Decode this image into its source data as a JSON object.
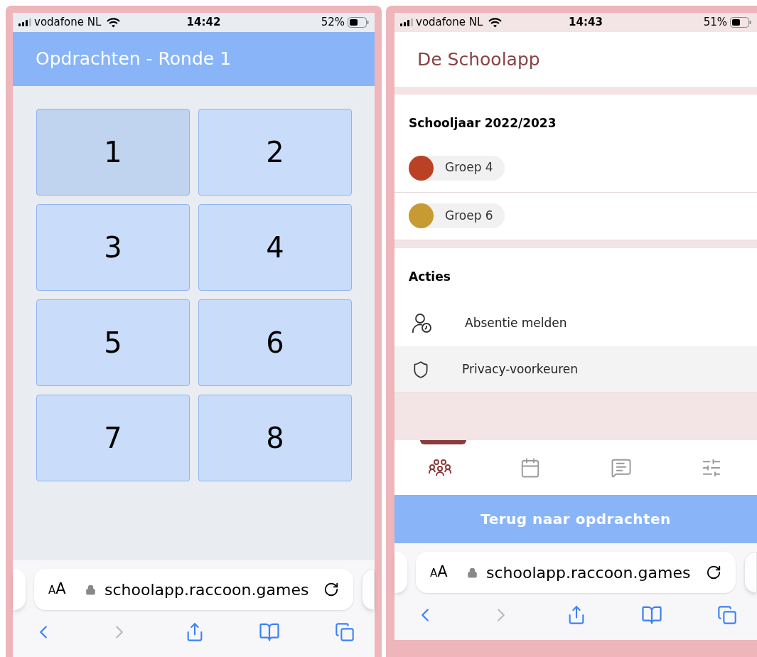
{
  "assignments_screen": {
    "status_bar": {
      "carrier": "vodafone NL",
      "time": "14:42",
      "battery": "52%"
    },
    "title": "Opdrachten - Ronde 1",
    "tiles": [
      {
        "label": "1",
        "selected": true
      },
      {
        "label": "2",
        "selected": false
      },
      {
        "label": "3",
        "selected": false
      },
      {
        "label": "4",
        "selected": false
      },
      {
        "label": "5",
        "selected": false
      },
      {
        "label": "6",
        "selected": false
      },
      {
        "label": "7",
        "selected": false
      },
      {
        "label": "8",
        "selected": false
      }
    ],
    "browser": {
      "text_size": "AA",
      "url": "schoolapp.raccoon.games",
      "forward_disabled": true
    }
  },
  "schoolapp_screen": {
    "status_bar": {
      "carrier": "vodafone NL",
      "time": "14:43",
      "battery": "51%"
    },
    "title": "De Schoolapp",
    "year_heading": "Schooljaar 2022/2023",
    "groups": [
      {
        "name": "Groep 4",
        "color": "#bb4125"
      },
      {
        "name": "Groep 6",
        "color": "#c79a32"
      }
    ],
    "actions_heading": "Acties",
    "actions": [
      {
        "label": "Absentie melden",
        "selected": false
      },
      {
        "label": "Privacy-voorkeuren",
        "selected": true
      }
    ],
    "nav_tabs": [
      {
        "selected": true
      },
      {
        "selected": false
      },
      {
        "selected": false
      },
      {
        "selected": false
      }
    ],
    "back_button": "Terug naar opdrachten",
    "browser": {
      "text_size": "AA",
      "url": "schoolapp.raccoon.games",
      "forward_disabled": true
    }
  }
}
